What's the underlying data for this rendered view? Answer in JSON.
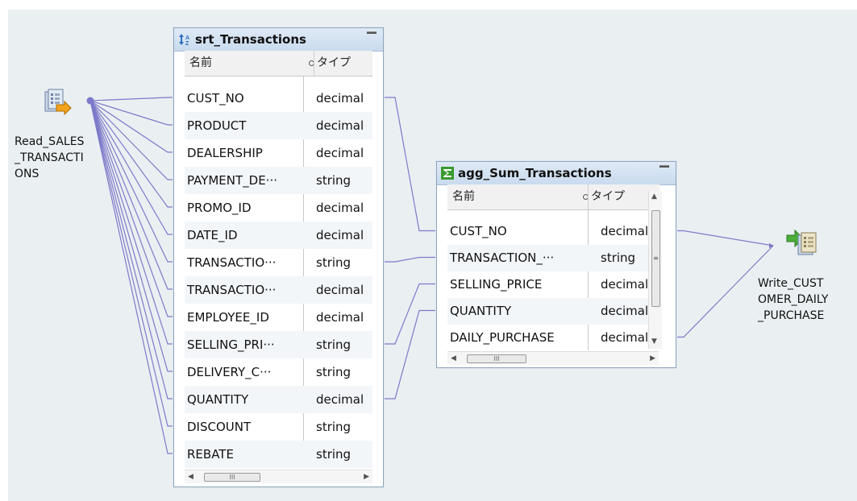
{
  "source_node": {
    "label": "Read_SALES\n_TRANSACTI\nONS",
    "icon": "read-source-icon"
  },
  "target_node": {
    "label": "Write_CUST\nOMER_DAILY\n_PURCHASE",
    "icon": "write-target-icon"
  },
  "sorter": {
    "title": "srt_Transactions",
    "icon": "sorter-icon",
    "header": {
      "name": "名前",
      "type": "タイプ"
    },
    "rows": [
      {
        "name": "CUST_NO",
        "type": "decimal"
      },
      {
        "name": "PRODUCT",
        "type": "decimal"
      },
      {
        "name": "DEALERSHIP",
        "type": "decimal"
      },
      {
        "name": "PAYMENT_DE···",
        "type": "string"
      },
      {
        "name": "PROMO_ID",
        "type": "decimal"
      },
      {
        "name": "DATE_ID",
        "type": "decimal"
      },
      {
        "name": "TRANSACTIO···",
        "type": "string"
      },
      {
        "name": "TRANSACTIO···",
        "type": "decimal"
      },
      {
        "name": "EMPLOYEE_ID",
        "type": "decimal"
      },
      {
        "name": "SELLING_PRI···",
        "type": "string"
      },
      {
        "name": "DELIVERY_C···",
        "type": "string"
      },
      {
        "name": "QUANTITY",
        "type": "decimal"
      },
      {
        "name": "DISCOUNT",
        "type": "string"
      },
      {
        "name": "REBATE",
        "type": "string"
      }
    ],
    "scroll_grip": "III"
  },
  "aggregator": {
    "title": "agg_Sum_Transactions",
    "icon": "sigma-icon",
    "header": {
      "name": "名前",
      "type": "タイプ"
    },
    "rows": [
      {
        "name": "CUST_NO",
        "type": "decimal"
      },
      {
        "name": "TRANSACTION_···",
        "type": "string"
      },
      {
        "name": "SELLING_PRICE",
        "type": "decimal"
      },
      {
        "name": "QUANTITY",
        "type": "decimal"
      },
      {
        "name": "DAILY_PURCHASE",
        "type": "decimal"
      }
    ],
    "scroll_grip": "III",
    "vscroll_grip": "≡"
  },
  "links": [
    {
      "from": "Read_SALES_TRANSACTIONS",
      "to": "srt_Transactions",
      "fields": "all"
    },
    {
      "from": "srt_Transactions.CUST_NO",
      "to": "agg_Sum_Transactions.CUST_NO"
    },
    {
      "from": "srt_Transactions.TRANSACTIO···",
      "to": "agg_Sum_Transactions.TRANSACTION_···"
    },
    {
      "from": "srt_Transactions.SELLING_PRI···",
      "to": "agg_Sum_Transactions.SELLING_PRICE"
    },
    {
      "from": "srt_Transactions.QUANTITY",
      "to": "agg_Sum_Transactions.QUANTITY"
    },
    {
      "from": "agg_Sum_Transactions.CUST_NO",
      "to": "Write_CUSTOMER_DAILY_PURCHASE"
    },
    {
      "from": "agg_Sum_Transactions.DAILY_PURCHASE",
      "to": "Write_CUSTOMER_DAILY_PURCHASE"
    }
  ],
  "colors": {
    "link": "#7d7ac9",
    "canvas": "#eaeff2",
    "title_bar": "#d6e4f3"
  }
}
